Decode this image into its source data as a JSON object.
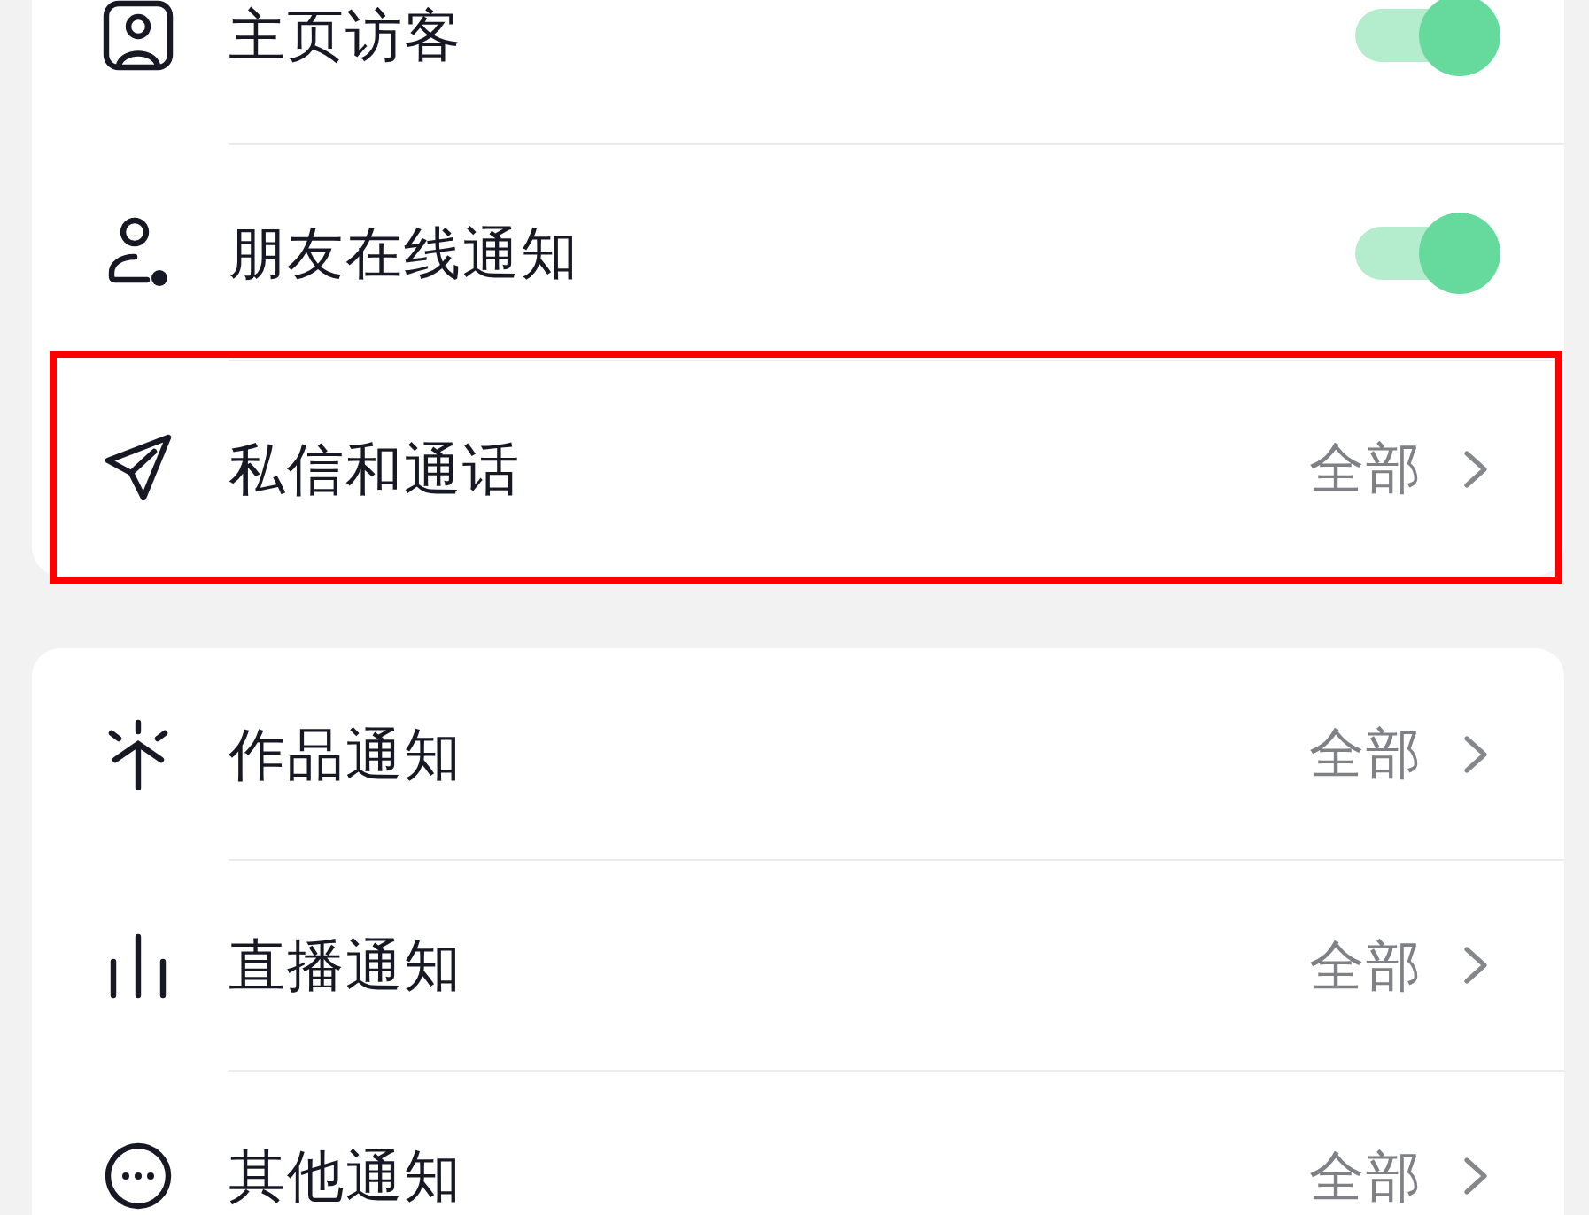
{
  "cards": [
    {
      "rows": [
        {
          "kind": "toggle",
          "label": "主页访客",
          "on": true,
          "highlighted": false
        },
        {
          "kind": "toggle",
          "label": "朋友在线通知",
          "on": true,
          "highlighted": false
        },
        {
          "kind": "link",
          "label": "私信和通话",
          "value": "全部",
          "highlighted": true
        }
      ]
    },
    {
      "rows": [
        {
          "kind": "link",
          "label": "作品通知",
          "value": "全部",
          "highlighted": false
        },
        {
          "kind": "link",
          "label": "直播通知",
          "value": "全部",
          "highlighted": false
        },
        {
          "kind": "link",
          "label": "其他通知",
          "value": "全部",
          "highlighted": false
        }
      ]
    }
  ]
}
